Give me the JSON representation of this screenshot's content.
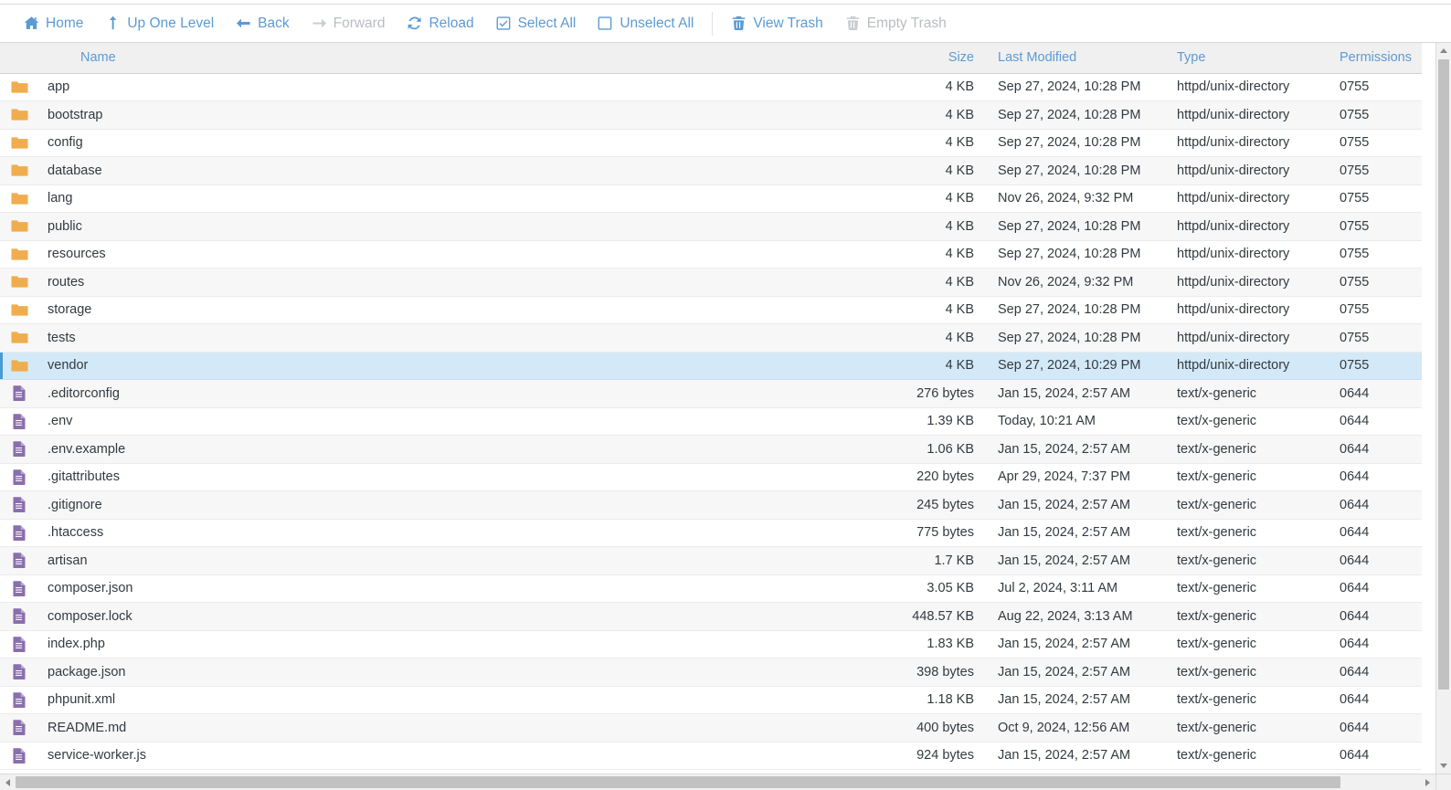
{
  "toolbar": {
    "buttons": [
      {
        "label": "Home",
        "icon": "home-icon",
        "disabled": false,
        "sep_after": false
      },
      {
        "label": "Up One Level",
        "icon": "arrow-up-icon",
        "disabled": false,
        "sep_after": false
      },
      {
        "label": "Back",
        "icon": "arrow-left-icon",
        "disabled": false,
        "sep_after": false
      },
      {
        "label": "Forward",
        "icon": "arrow-right-icon",
        "disabled": true,
        "sep_after": false
      },
      {
        "label": "Reload",
        "icon": "refresh-icon",
        "disabled": false,
        "sep_after": false
      },
      {
        "label": "Select All",
        "icon": "checkbox-checked-icon",
        "disabled": false,
        "sep_after": false
      },
      {
        "label": "Unselect All",
        "icon": "checkbox-empty-icon",
        "disabled": false,
        "sep_after": true
      },
      {
        "label": "View Trash",
        "icon": "trash-icon",
        "disabled": false,
        "sep_after": false
      },
      {
        "label": "Empty Trash",
        "icon": "trash-icon",
        "disabled": true,
        "sep_after": false
      }
    ]
  },
  "columns": {
    "name": "Name",
    "size": "Size",
    "modified": "Last Modified",
    "type": "Type",
    "permissions": "Permissions"
  },
  "colors": {
    "accent": "#5b9bd5",
    "folder": "#f0ad4e",
    "file": "#8a6fad",
    "selection": "#d3e9f7",
    "selection_bar": "#4a9ad4",
    "disabled": "#b9bdc2",
    "header_bg": "#f0f0f0"
  },
  "rows": [
    {
      "icon": "folder-icon",
      "name": "app",
      "size": "4 KB",
      "modified": "Sep 27, 2024, 10:28 PM",
      "type": "httpd/unix-directory",
      "permissions": "0755",
      "selected": false
    },
    {
      "icon": "folder-icon",
      "name": "bootstrap",
      "size": "4 KB",
      "modified": "Sep 27, 2024, 10:28 PM",
      "type": "httpd/unix-directory",
      "permissions": "0755",
      "selected": false
    },
    {
      "icon": "folder-icon",
      "name": "config",
      "size": "4 KB",
      "modified": "Sep 27, 2024, 10:28 PM",
      "type": "httpd/unix-directory",
      "permissions": "0755",
      "selected": false
    },
    {
      "icon": "folder-icon",
      "name": "database",
      "size": "4 KB",
      "modified": "Sep 27, 2024, 10:28 PM",
      "type": "httpd/unix-directory",
      "permissions": "0755",
      "selected": false
    },
    {
      "icon": "folder-icon",
      "name": "lang",
      "size": "4 KB",
      "modified": "Nov 26, 2024, 9:32 PM",
      "type": "httpd/unix-directory",
      "permissions": "0755",
      "selected": false
    },
    {
      "icon": "folder-icon",
      "name": "public",
      "size": "4 KB",
      "modified": "Sep 27, 2024, 10:28 PM",
      "type": "httpd/unix-directory",
      "permissions": "0755",
      "selected": false
    },
    {
      "icon": "folder-icon",
      "name": "resources",
      "size": "4 KB",
      "modified": "Sep 27, 2024, 10:28 PM",
      "type": "httpd/unix-directory",
      "permissions": "0755",
      "selected": false
    },
    {
      "icon": "folder-icon",
      "name": "routes",
      "size": "4 KB",
      "modified": "Nov 26, 2024, 9:32 PM",
      "type": "httpd/unix-directory",
      "permissions": "0755",
      "selected": false
    },
    {
      "icon": "folder-icon",
      "name": "storage",
      "size": "4 KB",
      "modified": "Sep 27, 2024, 10:28 PM",
      "type": "httpd/unix-directory",
      "permissions": "0755",
      "selected": false
    },
    {
      "icon": "folder-icon",
      "name": "tests",
      "size": "4 KB",
      "modified": "Sep 27, 2024, 10:28 PM",
      "type": "httpd/unix-directory",
      "permissions": "0755",
      "selected": false
    },
    {
      "icon": "folder-icon",
      "name": "vendor",
      "size": "4 KB",
      "modified": "Sep 27, 2024, 10:29 PM",
      "type": "httpd/unix-directory",
      "permissions": "0755",
      "selected": true
    },
    {
      "icon": "file-icon",
      "name": ".editorconfig",
      "size": "276 bytes",
      "modified": "Jan 15, 2024, 2:57 AM",
      "type": "text/x-generic",
      "permissions": "0644",
      "selected": false
    },
    {
      "icon": "file-icon",
      "name": ".env",
      "size": "1.39 KB",
      "modified": "Today, 10:21 AM",
      "type": "text/x-generic",
      "permissions": "0644",
      "selected": false
    },
    {
      "icon": "file-icon",
      "name": ".env.example",
      "size": "1.06 KB",
      "modified": "Jan 15, 2024, 2:57 AM",
      "type": "text/x-generic",
      "permissions": "0644",
      "selected": false
    },
    {
      "icon": "file-icon",
      "name": ".gitattributes",
      "size": "220 bytes",
      "modified": "Apr 29, 2024, 7:37 PM",
      "type": "text/x-generic",
      "permissions": "0644",
      "selected": false
    },
    {
      "icon": "file-icon",
      "name": ".gitignore",
      "size": "245 bytes",
      "modified": "Jan 15, 2024, 2:57 AM",
      "type": "text/x-generic",
      "permissions": "0644",
      "selected": false
    },
    {
      "icon": "file-icon",
      "name": ".htaccess",
      "size": "775 bytes",
      "modified": "Jan 15, 2024, 2:57 AM",
      "type": "text/x-generic",
      "permissions": "0644",
      "selected": false
    },
    {
      "icon": "file-icon",
      "name": "artisan",
      "size": "1.7 KB",
      "modified": "Jan 15, 2024, 2:57 AM",
      "type": "text/x-generic",
      "permissions": "0644",
      "selected": false
    },
    {
      "icon": "file-icon",
      "name": "composer.json",
      "size": "3.05 KB",
      "modified": "Jul 2, 2024, 3:11 AM",
      "type": "text/x-generic",
      "permissions": "0644",
      "selected": false
    },
    {
      "icon": "file-icon",
      "name": "composer.lock",
      "size": "448.57 KB",
      "modified": "Aug 22, 2024, 3:13 AM",
      "type": "text/x-generic",
      "permissions": "0644",
      "selected": false
    },
    {
      "icon": "file-icon",
      "name": "index.php",
      "size": "1.83 KB",
      "modified": "Jan 15, 2024, 2:57 AM",
      "type": "text/x-generic",
      "permissions": "0644",
      "selected": false
    },
    {
      "icon": "file-icon",
      "name": "package.json",
      "size": "398 bytes",
      "modified": "Jan 15, 2024, 2:57 AM",
      "type": "text/x-generic",
      "permissions": "0644",
      "selected": false
    },
    {
      "icon": "file-icon",
      "name": "phpunit.xml",
      "size": "1.18 KB",
      "modified": "Jan 15, 2024, 2:57 AM",
      "type": "text/x-generic",
      "permissions": "0644",
      "selected": false
    },
    {
      "icon": "file-icon",
      "name": "README.md",
      "size": "400 bytes",
      "modified": "Oct 9, 2024, 12:56 AM",
      "type": "text/x-generic",
      "permissions": "0644",
      "selected": false
    },
    {
      "icon": "file-icon",
      "name": "service-worker.js",
      "size": "924 bytes",
      "modified": "Jan 15, 2024, 2:57 AM",
      "type": "text/x-generic",
      "permissions": "0644",
      "selected": false
    }
  ]
}
